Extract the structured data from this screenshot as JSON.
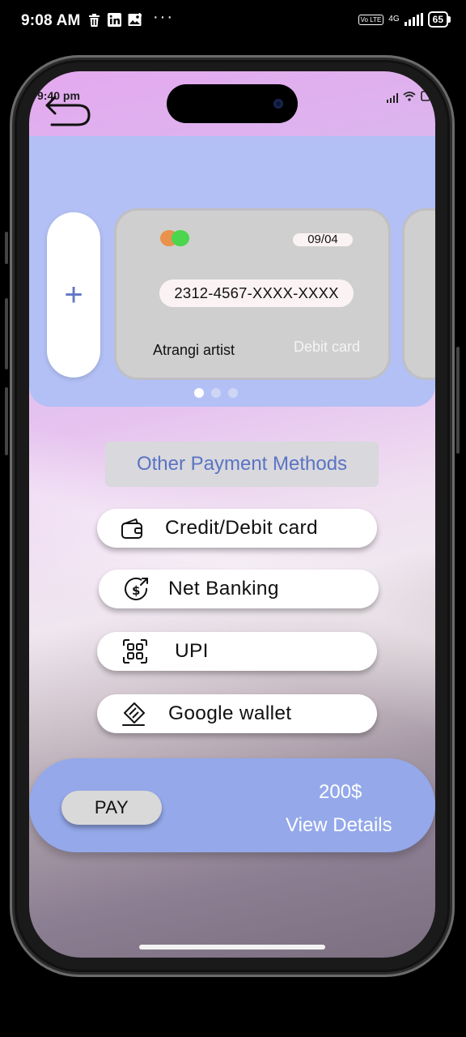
{
  "os_status": {
    "time": "9:08 AM",
    "notification_icons": [
      "delete-icon",
      "linkedin-icon",
      "gallery-icon"
    ],
    "more": "···",
    "volte": "Vo LTE",
    "network": "4G",
    "battery": "65"
  },
  "app_status": {
    "time": "9:40 pm"
  },
  "cards": {
    "add_label": "+",
    "current": {
      "expiry": "09/04",
      "number": "2312-4567-XXXX-XXXX",
      "holder": "Atrangi artist",
      "type": "Debit card"
    },
    "pager": {
      "count": 3,
      "active": 0
    }
  },
  "payment": {
    "section_title": "Other Payment Methods",
    "methods": [
      {
        "label": "Credit/Debit card",
        "icon": "wallet-icon"
      },
      {
        "label": "Net Banking",
        "icon": "dollar-exchange-icon"
      },
      {
        "label": "UPI",
        "icon": "qr-code-icon"
      },
      {
        "label": "Google wallet",
        "icon": "card-tag-icon"
      }
    ]
  },
  "pay_bar": {
    "button_label": "PAY",
    "amount": "200$",
    "details_label": "View Details"
  },
  "colors": {
    "card_area": "#b2c0f5",
    "pay_bar": "#94a8ea",
    "accent_text": "#5b73c3"
  }
}
